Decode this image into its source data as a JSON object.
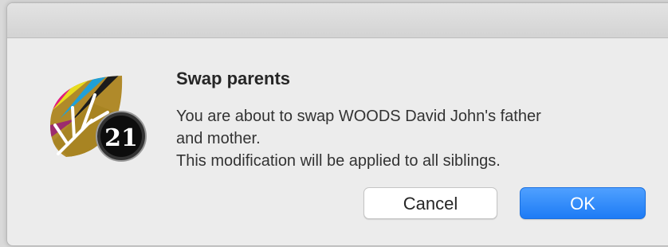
{
  "dialog": {
    "title": "Swap parents",
    "message_lines": [
      "You are about to swap WOODS David John's father",
      "and mother.",
      "This modification will be applied to all siblings."
    ],
    "buttons": {
      "cancel_label": "Cancel",
      "ok_label": "OK"
    },
    "app_icon": {
      "name": "heredis-app-icon",
      "badge_text": "21"
    }
  },
  "colors": {
    "accent": "#1d7bf5",
    "window_bg": "#ececec"
  }
}
